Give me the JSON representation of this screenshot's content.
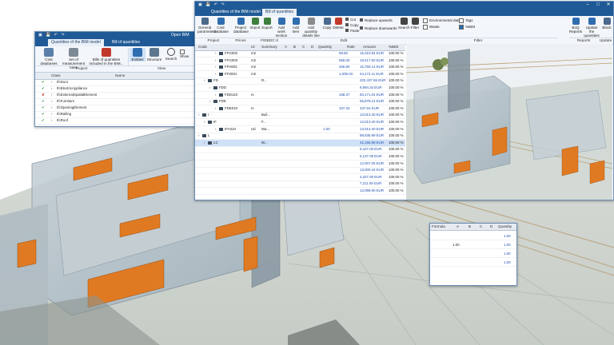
{
  "back_window": {
    "title": "Open BIM Qu",
    "tabs": [
      "Quantities of the BIM model",
      "Bill of quantities"
    ],
    "ribbon": {
      "buttons": [
        "Cost databases",
        "Set of measurement rules",
        "Bills of quantities included in the BIM...",
        "Entities",
        "Structure",
        "Search"
      ],
      "show_label": "Show",
      "groups": [
        "Project",
        "View"
      ]
    },
    "table": {
      "headers": [
        "Class",
        "Name"
      ],
      "rows": [
        {
          "status": "check",
          "name": "IfcDoor"
        },
        {
          "status": "check",
          "name": "IfcElectricAppliance"
        },
        {
          "status": "cross",
          "name": "IfcExternalSpatialElement"
        },
        {
          "status": "check",
          "name": "IfcFurniture"
        },
        {
          "status": "check",
          "name": "IfcOpeningElement"
        },
        {
          "status": "check",
          "name": "IfcRailing"
        },
        {
          "status": "check",
          "name": "IfcRoof"
        }
      ]
    },
    "bottom": {
      "headers": [
        "Formula",
        "A",
        "B",
        "C",
        "D",
        "Quantity"
      ],
      "rows": [
        {
          "a": "",
          "qty": "1.00"
        },
        {
          "a": "1.00",
          "qty": "1.00"
        },
        {
          "a": "",
          "qty": "1.00"
        },
        {
          "a": "",
          "qty": "1.00"
        }
      ]
    }
  },
  "front_window": {
    "tabs": [
      "Quantities of the BIM model",
      "Bill of quantities"
    ],
    "ribbon": {
      "buttons": [
        "General parameters",
        "Cost database",
        "Project database",
        "Import",
        "Export",
        "Add work section",
        "Add item",
        "Add quantity details line",
        "Copy",
        "Delete",
        "Cut",
        "Copy",
        "Paste",
        "Replace upwards",
        "Replace downwards",
        "Search",
        "Filter",
        "Environmental data",
        "Waste",
        "Tags",
        "%BIM",
        "BoQ Reports",
        "Update the quantities",
        "Block"
      ],
      "groups": [
        "Project",
        "Prices",
        "FIEBDC-3",
        "Edit",
        "Filter",
        "Reports",
        "Update"
      ]
    },
    "table": {
      "headers": [
        "Code",
        "Ut",
        "Summary",
        "A",
        "B",
        "C",
        "D",
        "Quantity",
        "Rate",
        "Amount",
        "%BIM"
      ],
      "rows": [
        {
          "indent": 3,
          "code": "FFG002",
          "ut": "m2",
          "summary": "",
          "qty": "",
          "rate": "99.50",
          "amount": "16,310.94 EUR",
          "bim": "100.00 %",
          "sel": false
        },
        {
          "indent": 3,
          "code": "FFG003",
          "ut": "m2",
          "summary": "",
          "qty": "",
          "rate": "555.00",
          "amount": "19,417.60 EUR",
          "bim": "100.00 %",
          "sel": false
        },
        {
          "indent": 3,
          "code": "FFH001",
          "ut": "m2",
          "summary": "",
          "qty": "",
          "rate": "260.80",
          "amount": "15,750.14 EUR",
          "bim": "100.00 %",
          "sel": false
        },
        {
          "indent": 3,
          "code": "FFZ001",
          "ut": "m2",
          "summary": "",
          "qty": "",
          "rate": "1,009.03",
          "amount": "24,172.11 EUR",
          "bim": "100.00 %",
          "sel": false
        },
        {
          "indent": 1,
          "code": "FD",
          "ut": "",
          "summary": "R...",
          "qty": "",
          "rate": "",
          "amount": "202,437.55 EUR",
          "bim": "100.00 %",
          "sel": false
        },
        {
          "indent": 2,
          "code": "FDD",
          "ut": "",
          "summary": "",
          "qty": "",
          "rate": "",
          "amount": "8,994.34 EUR",
          "bim": "100.00 %",
          "sel": false
        },
        {
          "indent": 3,
          "code": "FDD110",
          "ut": "m",
          "summary": "",
          "qty": "",
          "rate": "168.37",
          "amount": "83,171.04 EUR",
          "bim": "100.00 %",
          "sel": false
        },
        {
          "indent": 2,
          "code": "FDE",
          "ut": "",
          "summary": "",
          "qty": "",
          "rate": "",
          "amount": "65,878.21 EUR",
          "bim": "100.00 %",
          "sel": false
        },
        {
          "indent": 3,
          "code": "FDE010",
          "ut": "m",
          "summary": "",
          "qty": "",
          "rate": "107.32",
          "amount": "347.64 EUR",
          "bim": "100.00 %",
          "sel": false
        },
        {
          "indent": 0,
          "code": "I",
          "ut": "",
          "summary": "Buil...",
          "qty": "",
          "rate": "",
          "amount": "13,013.40 EUR",
          "bim": "100.00 %",
          "sel": false
        },
        {
          "indent": 1,
          "code": "IF",
          "ut": "",
          "summary": "F...",
          "qty": "",
          "rate": "",
          "amount": "13,013.40 EUR",
          "bim": "100.00 %",
          "sel": false
        },
        {
          "indent": 3,
          "code": "IFA010",
          "ut": "Ud",
          "summary": "Wa...",
          "qty": "1.00",
          "rate": "",
          "amount": "13,013.40 EUR",
          "bim": "100.00 %",
          "sel": false
        },
        {
          "indent": 0,
          "code": "L",
          "ut": "",
          "summary": "",
          "qty": "",
          "rate": "",
          "amount": "98,636.89 EUR",
          "bim": "100.00 %",
          "sel": false
        },
        {
          "indent": 1,
          "code": "LC",
          "ut": "",
          "summary": "W...",
          "qty": "",
          "rate": "",
          "amount": "42,166.98 EUR",
          "bim": "100.00 %",
          "sel": true
        },
        {
          "indent": 0,
          "code": "",
          "ut": "",
          "summary": "",
          "qty": "",
          "rate": "",
          "amount": "9,427.00 EUR",
          "bim": "100.00 %",
          "sel": false
        },
        {
          "indent": 0,
          "code": "",
          "ut": "",
          "summary": "",
          "qty": "",
          "rate": "",
          "amount": "5,137.05 EUR",
          "bim": "100.00 %",
          "sel": false
        },
        {
          "indent": 0,
          "code": "",
          "ut": "",
          "summary": "",
          "qty": "",
          "rate": "",
          "amount": "12,007.05 EUR",
          "bim": "100.00 %",
          "sel": false
        },
        {
          "indent": 0,
          "code": "",
          "ut": "",
          "summary": "",
          "qty": "",
          "rate": "",
          "amount": "13,000.42 EUR",
          "bim": "100.00 %",
          "sel": false
        },
        {
          "indent": 0,
          "code": "",
          "ut": "",
          "summary": "",
          "qty": "",
          "rate": "",
          "amount": "4,327.00 EUR",
          "bim": "100.00 %",
          "sel": false
        },
        {
          "indent": 0,
          "code": "",
          "ut": "",
          "summary": "",
          "qty": "",
          "rate": "",
          "amount": "7,211.05 EUR",
          "bim": "100.00 %",
          "sel": false
        },
        {
          "indent": 0,
          "code": "",
          "ut": "",
          "summary": "",
          "qty": "",
          "rate": "",
          "amount": "13,099.00 EUR",
          "bim": "100.00 %",
          "sel": false
        }
      ]
    }
  },
  "colors": {
    "titlebar": "#1f5a96",
    "ribbon_bg": "#f3f6fa",
    "orange_panel": "#e07a22",
    "glass": "#b8c6cf",
    "selection": "#cfe1f7"
  }
}
